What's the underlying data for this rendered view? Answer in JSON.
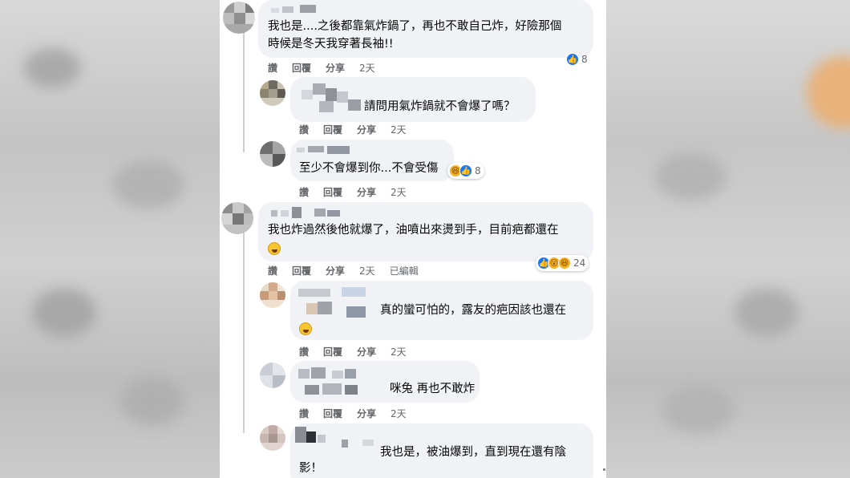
{
  "comments": [
    {
      "id": "c1",
      "text_lines": [
        "我也是....之後都靠氣炸鍋了，再也不敢自己炸，好險那個",
        "時候是冬天我穿著長袖!!"
      ],
      "actions": {
        "like": "讚",
        "reply": "回覆",
        "share": "分享",
        "time": "2天"
      },
      "reaction_count": "8",
      "reaction_types": [
        "like"
      ]
    },
    {
      "id": "r1",
      "text_lines": [
        "請問用氣炸鍋就不會爆了嗎？"
      ],
      "actions": {
        "like": "讚",
        "reply": "回覆",
        "share": "分享",
        "time": "2天"
      }
    },
    {
      "id": "r2",
      "text_lines": [
        "至少不會爆到你...不會受傷"
      ],
      "actions": {
        "like": "讚",
        "reply": "回覆",
        "share": "分享",
        "time": "2天"
      },
      "reaction_count": "8",
      "reaction_types": [
        "haha",
        "like"
      ]
    },
    {
      "id": "c2",
      "text_lines": [
        "我也炸過然後他就爆了，油噴出來燙到手，目前疤都還在"
      ],
      "actions": {
        "like": "讚",
        "reply": "回覆",
        "share": "分享",
        "time": "2天",
        "edited": "已編輯"
      },
      "reaction_count": "24",
      "reaction_types": [
        "like",
        "wow",
        "haha"
      ]
    },
    {
      "id": "r3",
      "text_lines": [
        "真的蠻可怕的，露友的疤因該也還在"
      ],
      "actions": {
        "like": "讚",
        "reply": "回覆",
        "share": "分享",
        "time": "2天"
      }
    },
    {
      "id": "r4",
      "text_lines": [
        "咪兔 再也不敢炸"
      ],
      "actions": {
        "like": "讚",
        "reply": "回覆",
        "share": "分享",
        "time": "2天"
      }
    },
    {
      "id": "r5",
      "text_lines": [
        "我也是，被油爆到，直到現在還有陰",
        "影！"
      ]
    }
  ],
  "colors": {
    "bubble": "#f0f2f5",
    "text": "#050505",
    "meta": "#65676b",
    "like_blue": "#1877f2"
  },
  "icons": [
    "like-icon",
    "haha-icon",
    "wow-icon",
    "emoji"
  ]
}
